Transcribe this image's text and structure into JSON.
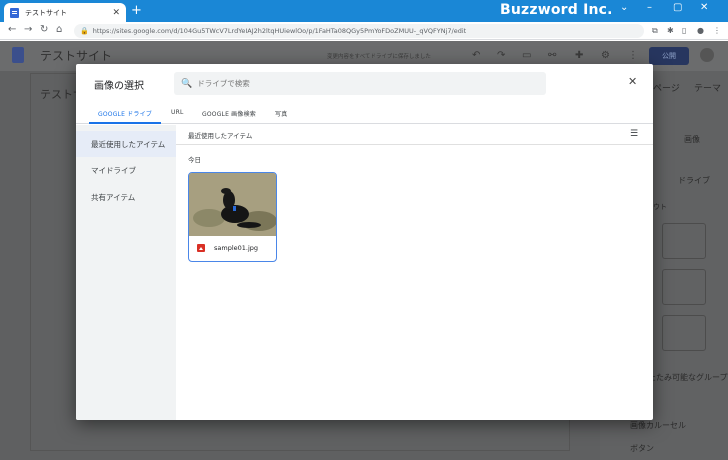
{
  "browser": {
    "tab_title": "テストサイト",
    "new_tab": "+",
    "brand": "Buzzword Inc.",
    "url": "https://sites.google.com/d/104Gu5TWcV7LrdYeIAJ2h2ltqHUiewlOo/p/1FaHTa08QGy5PmYoFDoZMUU-_qVQFYNj7/edit",
    "win_controls": [
      "⌄",
      "–",
      "▢",
      "✕"
    ],
    "nav_icons": [
      "←",
      "→",
      "↻",
      "⌂"
    ]
  },
  "site": {
    "title": "テストサイト",
    "save_hint": "変更内容をすべてドライブに保存しました",
    "publish_label": "公開",
    "editor_text": "テストサ",
    "panel_tabs": [
      "ページ",
      "テーマ"
    ],
    "insert_image": "画像",
    "insert_drive": "ドライブ",
    "layouts_label": "ウト",
    "collapsible": "たたみ可能なグループ",
    "carousel": "画像カルーセル",
    "button": "ボタン"
  },
  "dialog": {
    "title": "画像の選択",
    "search_placeholder": "ドライブで検索",
    "close_icon": "close-icon",
    "tabs": [
      "GOOGLE ドライブ",
      "URL",
      "GOOGLE 画像検索",
      "写真"
    ],
    "active_tab": 0,
    "sidebar": [
      "最近使用したアイテム",
      "マイドライブ",
      "共有アイテム"
    ],
    "selected_sidebar": 0,
    "section_header": "最近使用したアイテム",
    "group_label": "今日",
    "files": [
      {
        "name": "sample01.jpg",
        "type_icon": "image-file-icon"
      }
    ]
  },
  "colors": {
    "accent": "#1a73e8",
    "chrome": "#1a87d6",
    "file_icon": "#d93025"
  }
}
